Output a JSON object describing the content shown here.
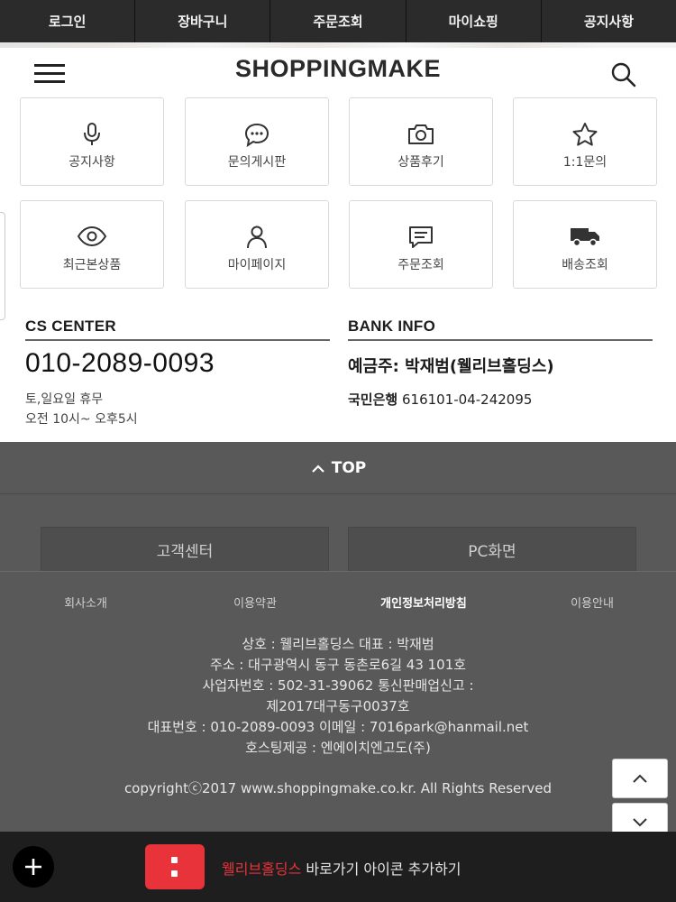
{
  "top_nav": [
    "로그인",
    "장바구니",
    "주문조회",
    "마이쇼핑",
    "공지사항"
  ],
  "header": {
    "logo": "SHOPPINGMAKE"
  },
  "tiles": [
    {
      "label": "공지사항",
      "icon": "microphone-icon"
    },
    {
      "label": "문의게시판",
      "icon": "chat-bubble-icon"
    },
    {
      "label": "상품후기",
      "icon": "camera-icon"
    },
    {
      "label": "1:1문의",
      "icon": "star-icon"
    },
    {
      "label": "최근본상품",
      "icon": "eye-icon"
    },
    {
      "label": "마이페이지",
      "icon": "person-icon"
    },
    {
      "label": "주문조회",
      "icon": "message-icon"
    },
    {
      "label": "배송조회",
      "icon": "truck-icon"
    }
  ],
  "cs": {
    "title": "CS CENTER",
    "phone": "010-2089-0093",
    "hours1": "토,일요일 휴무",
    "hours2": "오전 10시~ 오후5시"
  },
  "bank": {
    "title": "BANK INFO",
    "holder": "예금주: 박재범(웰리브홀딩스)",
    "bank_name": "국민은행",
    "account": "616101-04-242095"
  },
  "footer": {
    "top_label": "TOP",
    "btn_cs": "고객센터",
    "btn_pc": "PC화면",
    "links": [
      "회사소개",
      "이용약관",
      "개인정보처리방침",
      "이용안내"
    ],
    "info": [
      "상호 : 웰리브홀딩스 대표 : 박재범",
      "주소 : 대구광역시 동구 동촌로6길 43 101호",
      "사업자번호 : 502-31-39062 통신판매업신고 :",
      "제2017대구동구0037호",
      "대표번호 : 010-2089-0093 이메일 : 7016park@hanmail.net",
      "호스팅제공 : 엔에이치엔고도(주)"
    ],
    "copyright": "copyrightⓒ2017 www.shoppingmake.co.kr. All Rights Reserved"
  },
  "bottom_bar": {
    "brand": "웰리브홀딩스",
    "text": " 바로가기 아이콘 추가하기"
  },
  "colors": {
    "accent_red": "#e8333a",
    "dark_nav": "#2b2b2b",
    "footer_bg": "#595959"
  }
}
